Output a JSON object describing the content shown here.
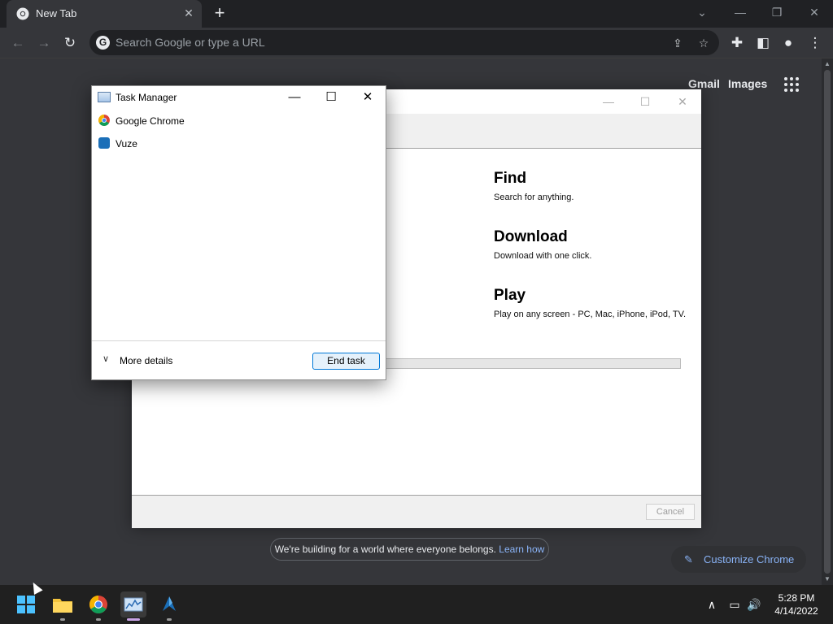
{
  "browser": {
    "tab": {
      "title": "New Tab"
    },
    "omnibox": {
      "placeholder": "Search Google or type a URL"
    }
  },
  "ntp": {
    "links": [
      "Gmail",
      "Images"
    ],
    "banner": {
      "text": "We're building for a world where everyone belongs.",
      "link": "Learn how"
    },
    "customize_label": "Customize Chrome"
  },
  "vuze_installer": {
    "features": [
      {
        "title": "Find",
        "desc": "Search for anything."
      },
      {
        "title": "Download",
        "desc": "Download with one click."
      },
      {
        "title": "Play",
        "desc": "Play on any screen - PC, Mac, iPhone, iPod, TV."
      }
    ],
    "cancel_label": "Cancel"
  },
  "task_manager": {
    "title": "Task Manager",
    "processes": [
      "Google Chrome",
      "Vuze"
    ],
    "more_details": "More details",
    "end_task": "End task"
  },
  "taskbar": {
    "time": "5:28 PM",
    "date": "4/14/2022"
  },
  "colors": {
    "chrome_dark": "#202124",
    "chrome_surface": "#35363a",
    "link_blue": "#8ab4f8",
    "accent_blue": "#0078d7",
    "taskbar": "#202020"
  }
}
